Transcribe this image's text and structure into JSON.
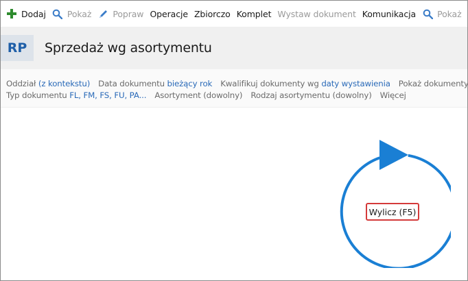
{
  "toolbar": {
    "items": [
      {
        "label": "Dodaj",
        "icon": "plus-icon",
        "enabled": true
      },
      {
        "label": "Pokaż",
        "icon": "search-icon",
        "enabled": false
      },
      {
        "label": "Popraw",
        "icon": "pencil-icon",
        "enabled": false
      },
      {
        "label": "Operacje",
        "icon": "",
        "enabled": true
      },
      {
        "label": "Zbiorczo",
        "icon": "",
        "enabled": true
      },
      {
        "label": "Komplet",
        "icon": "",
        "enabled": true
      },
      {
        "label": "Wystaw dokument",
        "icon": "",
        "enabled": false
      },
      {
        "label": "Komunikacja",
        "icon": "",
        "enabled": true
      },
      {
        "label": "Pokaż",
        "icon": "search-icon",
        "enabled": false
      }
    ],
    "colors": {
      "plus": "#2e8b2e",
      "search": "#3a7cc8",
      "pencil": "#3a7cc8",
      "disabled_text": "#9a9a9a"
    }
  },
  "header": {
    "badge": "RP",
    "title": "Sprzedaż wg asortymentu"
  },
  "filters": {
    "row1": [
      {
        "label": "Oddział",
        "value": "(z kontekstu)"
      },
      {
        "label": "Data dokumentu",
        "value": "bieżący rok"
      },
      {
        "label": "Kwalifikuj dokumenty wg",
        "value": "daty wystawienia"
      },
      {
        "label": "Pokaż dokumenty zal",
        "value": ""
      }
    ],
    "row2": [
      {
        "label": "Typ dokumentu",
        "value": "FL, FM, FS, FU, PA..."
      },
      {
        "label": "Asortyment (dowolny)",
        "value": ""
      },
      {
        "label": "Rodzaj asortymentu (dowolny)",
        "value": ""
      },
      {
        "label": "Więcej",
        "value": ""
      }
    ]
  },
  "main": {
    "compute_button": "Wylicz (F5)",
    "accent_color": "#1a7fd4"
  }
}
